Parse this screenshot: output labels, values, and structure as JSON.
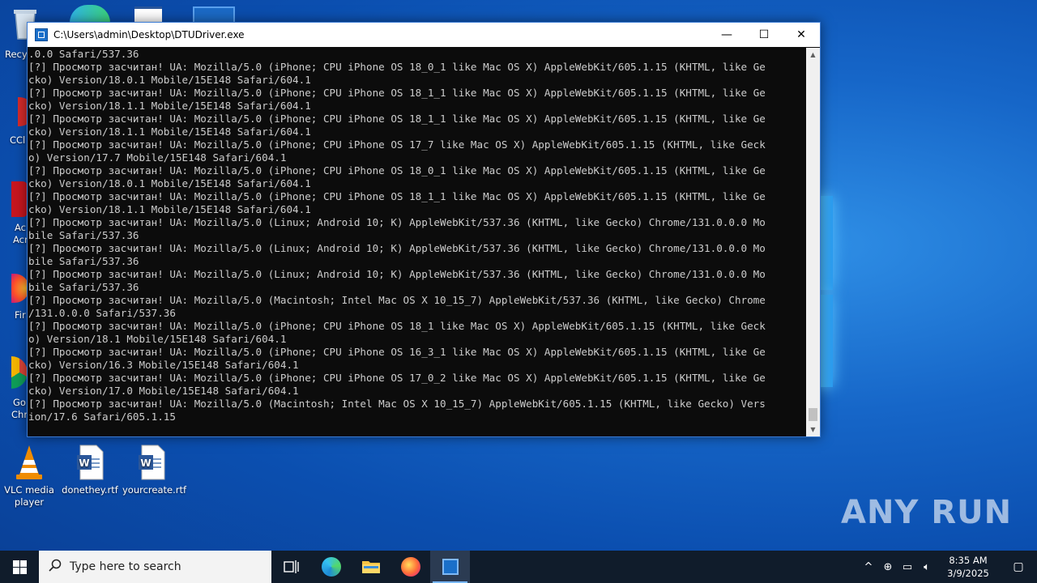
{
  "desktop": {
    "left_labels": [
      "Recy",
      "CCl",
      "Ac",
      "Acr",
      "Fir",
      "Go",
      "Chro"
    ],
    "icons": [
      {
        "label": "VLC media player"
      },
      {
        "label": "donethey.rtf"
      },
      {
        "label": "yourcreate.rtf"
      }
    ]
  },
  "console_window": {
    "title": "C:\\Users\\admin\\Desktop\\DTUDriver.exe",
    "buttons": {
      "minimize": "—",
      "maximize": "☐",
      "close": "✕"
    },
    "lines": [
      ".0.0 Safari/537.36",
      "[?] Просмотр засчитан! UA: Mozilla/5.0 (iPhone; CPU iPhone OS 18_0_1 like Mac OS X) AppleWebKit/605.1.15 (KHTML, like Ge",
      "cko) Version/18.0.1 Mobile/15E148 Safari/604.1",
      "[?] Просмотр засчитан! UA: Mozilla/5.0 (iPhone; CPU iPhone OS 18_1_1 like Mac OS X) AppleWebKit/605.1.15 (KHTML, like Ge",
      "cko) Version/18.1.1 Mobile/15E148 Safari/604.1",
      "[?] Просмотр засчитан! UA: Mozilla/5.0 (iPhone; CPU iPhone OS 18_1_1 like Mac OS X) AppleWebKit/605.1.15 (KHTML, like Ge",
      "cko) Version/18.1.1 Mobile/15E148 Safari/604.1",
      "[?] Просмотр засчитан! UA: Mozilla/5.0 (iPhone; CPU iPhone OS 17_7 like Mac OS X) AppleWebKit/605.1.15 (KHTML, like Geck",
      "o) Version/17.7 Mobile/15E148 Safari/604.1",
      "[?] Просмотр засчитан! UA: Mozilla/5.0 (iPhone; CPU iPhone OS 18_0_1 like Mac OS X) AppleWebKit/605.1.15 (KHTML, like Ge",
      "cko) Version/18.0.1 Mobile/15E148 Safari/604.1",
      "[?] Просмотр засчитан! UA: Mozilla/5.0 (iPhone; CPU iPhone OS 18_1_1 like Mac OS X) AppleWebKit/605.1.15 (KHTML, like Ge",
      "cko) Version/18.1.1 Mobile/15E148 Safari/604.1",
      "[?] Просмотр засчитан! UA: Mozilla/5.0 (Linux; Android 10; K) AppleWebKit/537.36 (KHTML, like Gecko) Chrome/131.0.0.0 Mo",
      "bile Safari/537.36",
      "[?] Просмотр засчитан! UA: Mozilla/5.0 (Linux; Android 10; K) AppleWebKit/537.36 (KHTML, like Gecko) Chrome/131.0.0.0 Mo",
      "bile Safari/537.36",
      "[?] Просмотр засчитан! UA: Mozilla/5.0 (Linux; Android 10; K) AppleWebKit/537.36 (KHTML, like Gecko) Chrome/131.0.0.0 Mo",
      "bile Safari/537.36",
      "[?] Просмотр засчитан! UA: Mozilla/5.0 (Macintosh; Intel Mac OS X 10_15_7) AppleWebKit/537.36 (KHTML, like Gecko) Chrome",
      "/131.0.0.0 Safari/537.36",
      "[?] Просмотр засчитан! UA: Mozilla/5.0 (iPhone; CPU iPhone OS 18_1 like Mac OS X) AppleWebKit/605.1.15 (KHTML, like Geck",
      "o) Version/18.1 Mobile/15E148 Safari/604.1",
      "[?] Просмотр засчитан! UA: Mozilla/5.0 (iPhone; CPU iPhone OS 16_3_1 like Mac OS X) AppleWebKit/605.1.15 (KHTML, like Ge",
      "cko) Version/16.3 Mobile/15E148 Safari/604.1",
      "[?] Просмотр засчитан! UA: Mozilla/5.0 (iPhone; CPU iPhone OS 17_0_2 like Mac OS X) AppleWebKit/605.1.15 (KHTML, like Ge",
      "cko) Version/17.0 Mobile/15E148 Safari/604.1",
      "[?] Просмотр засчитан! UA: Mozilla/5.0 (Macintosh; Intel Mac OS X 10_15_7) AppleWebKit/605.1.15 (KHTML, like Gecko) Vers",
      "ion/17.6 Safari/605.1.15"
    ]
  },
  "taskbar": {
    "search_placeholder": "Type here to search",
    "clock_time": "8:35 AM",
    "clock_date": "3/9/2025"
  },
  "watermark": "ANY RUN",
  "colors": {
    "console_bg": "#0c0c0c",
    "console_text": "#cccccc",
    "taskbar_bg": "#101c2b",
    "desktop_blue": "#1666c8"
  }
}
